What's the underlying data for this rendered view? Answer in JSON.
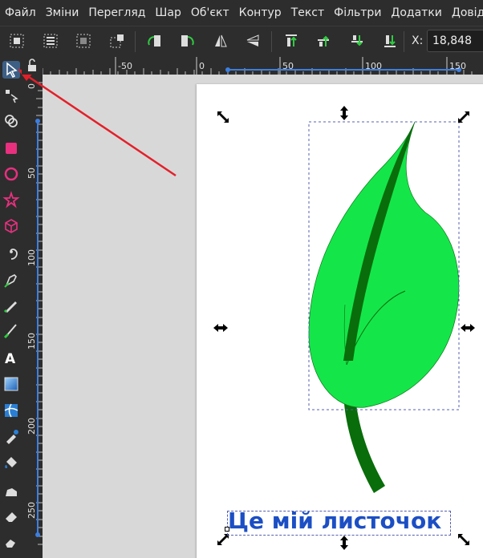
{
  "menu": [
    "Файл",
    "Зміни",
    "Перегляд",
    "Шар",
    "Об'єкт",
    "Контур",
    "Текст",
    "Фільтри",
    "Додатки",
    "Довідка"
  ],
  "toolbar": {
    "x_label": "X:",
    "x_value": "18,848",
    "icons": [
      "select-all-icon",
      "select-all-layers-icon",
      "deselect-icon",
      "touch-select-icon",
      "rotate-ccw-icon",
      "rotate-cw-icon",
      "flip-horizontal-icon",
      "flip-vertical-icon",
      "raise-to-top-icon",
      "raise-icon",
      "lower-icon",
      "lower-to-bottom-icon"
    ]
  },
  "tools": [
    "selector-tool",
    "node-tool",
    "tweak-tool",
    "rectangle-tool",
    "ellipse-tool",
    "star-tool",
    "box-3d-tool",
    "spiral-tool",
    "pen-tool",
    "pencil-tool",
    "calligraphy-tool",
    "text-tool",
    "gradient-tool",
    "mesh-tool",
    "dropper-tool",
    "paint-bucket-tool",
    "spray-tool",
    "eraser-tool"
  ],
  "ruler": {
    "h_labels": [
      "-50",
      "0",
      "50",
      "100",
      "150"
    ],
    "v_labels": [
      "0",
      "50",
      "100",
      "150",
      "200",
      "250"
    ]
  },
  "canvas": {
    "caption": "Це мій листочок",
    "leaf_fill": "#14e64a",
    "stem_fill": "#086d0a",
    "text_color": "#1c4fc4"
  },
  "annotation": {
    "arrow_color": "#e3202a"
  }
}
